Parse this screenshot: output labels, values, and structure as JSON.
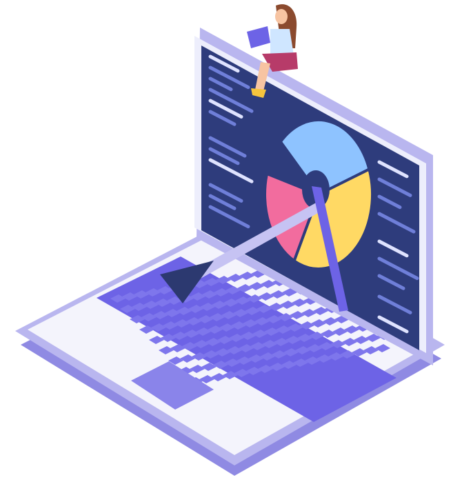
{
  "illustration": {
    "subject": "isometric-laptop-with-pie-chart",
    "colors": {
      "background": "#ffffff",
      "laptop_body": "#f3f3fb",
      "laptop_rim": "#b9b6ef",
      "laptop_shadow": "#8f8ae3",
      "screen": "#2e3c7c",
      "screen_lines": "#6f7fd9",
      "screen_lines_light": "#dfe3ff",
      "keyboard": "#6d63e6",
      "keys": "#7e76ec",
      "touchpad": "#8a84ea",
      "pie_blue": "#8ec3ff",
      "pie_pink": "#f26c9e",
      "pie_yellow": "#ffd964",
      "pointer": "#2c3970",
      "pointer_stick": "#c6c3f3",
      "woman_hair": "#8b4a2e",
      "woman_skin": "#f7c4a2",
      "woman_top": "#cfe6ff",
      "woman_skirt": "#b73b69",
      "woman_shoes": "#f6c43d"
    },
    "chart_data": {
      "type": "pie",
      "slices": [
        {
          "color": "#8ec3ff",
          "value": 0.32
        },
        {
          "color": "#ffd964",
          "value": 0.38
        },
        {
          "color": "#f26c9e",
          "value": 0.22
        },
        {
          "color": "#2e3c7c",
          "value": 0.08
        }
      ]
    }
  }
}
